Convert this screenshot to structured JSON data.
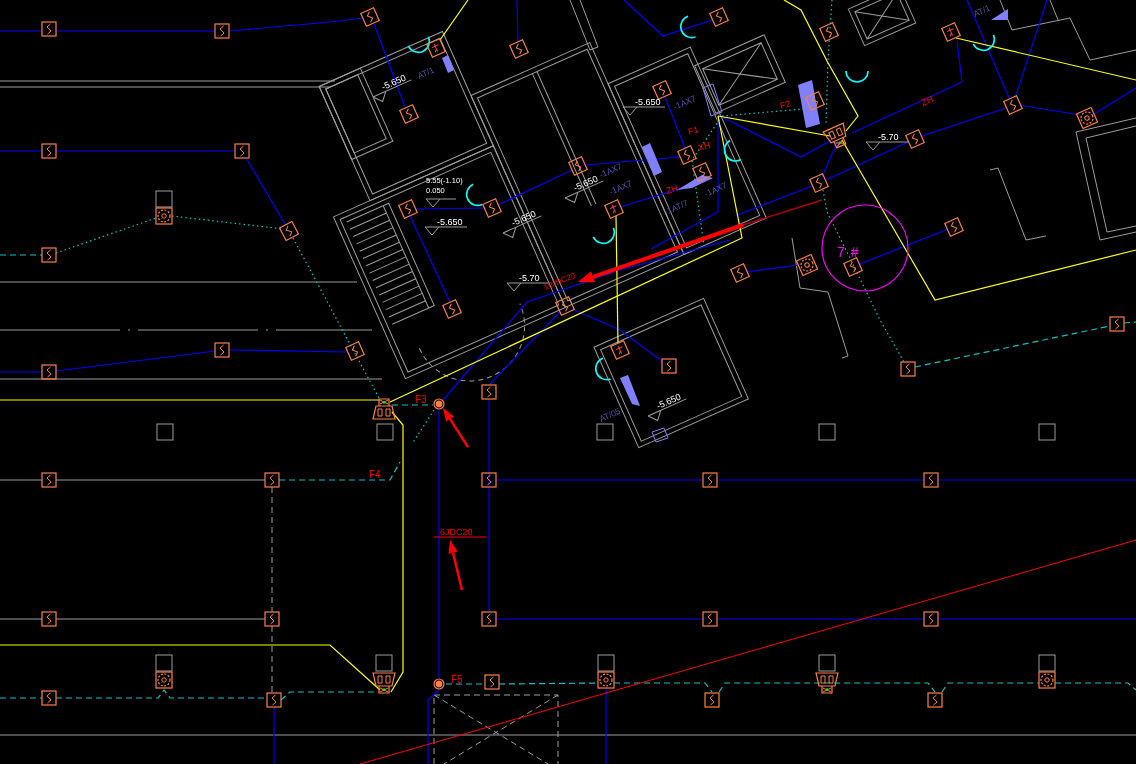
{
  "drawing": {
    "elevation_marks": [
      "-5.650",
      "-5.650",
      "-5.70",
      "-5.650",
      "-5.650",
      "-5.650",
      "-5.70",
      "-5.650"
    ],
    "floor_note": [
      "5.55(-1.10)",
      "0.050"
    ],
    "pipe_labels": [
      "ZH",
      "F2",
      "F1",
      "XH",
      "ZH",
      "10JDC20",
      "F3",
      "F4",
      "6JDC20",
      "F5"
    ],
    "zone_label": "7#",
    "equipment_tags": [
      "AT/1",
      "AT/1",
      "-1AX7",
      "-1AX7",
      "-1AX7",
      "-1AX7",
      "-1AT/7",
      "AT/05"
    ]
  }
}
